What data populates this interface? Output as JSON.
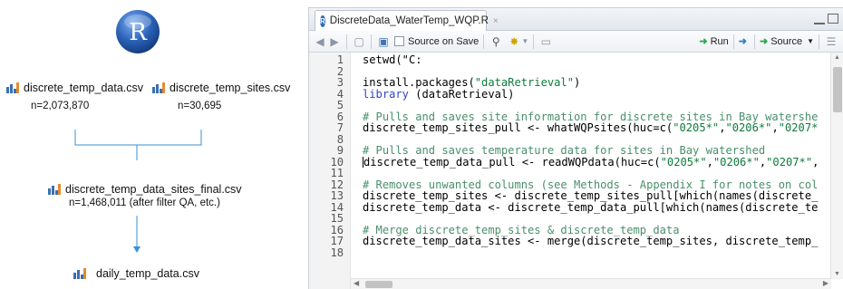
{
  "diagram": {
    "logo_letter": "R",
    "nodes": [
      {
        "id": "temp_data",
        "label": "discrete_temp_data.csv",
        "count": "n=2,073,870"
      },
      {
        "id": "temp_sites",
        "label": "discrete_temp_sites.csv",
        "count": "n=30,695"
      },
      {
        "id": "final",
        "label": "discrete_temp_data_sites_final.csv",
        "count": "n=1,468,011 (after filter QA, etc.)"
      },
      {
        "id": "daily",
        "label": "daily_temp_data.csv",
        "count": ""
      }
    ],
    "colors": {
      "logo": "#2a62b8",
      "connector": "#3a8fd6",
      "csv_icon": "#3a6fb0"
    }
  },
  "editor": {
    "tab_title": "DiscreteData_WaterTemp_WQP.R",
    "tab_icon": "r-file-icon",
    "tab_close": "×",
    "toolbar": {
      "source_on_save": "Source on Save",
      "run": "Run",
      "source": "Source"
    },
    "lines": [
      {
        "n": "1",
        "segments": [
          {
            "t": "setwd(\"C:",
            "c": ""
          }
        ]
      },
      {
        "n": "2",
        "segments": [
          {
            "t": "",
            "c": ""
          }
        ]
      },
      {
        "n": "3",
        "segments": [
          {
            "t": "install.packages(",
            "c": ""
          },
          {
            "t": "\"dataRetrieval\"",
            "c": "string"
          },
          {
            "t": ")",
            "c": ""
          }
        ]
      },
      {
        "n": "4",
        "segments": [
          {
            "t": "library",
            "c": "kw"
          },
          {
            "t": " (dataRetrieval)",
            "c": ""
          }
        ]
      },
      {
        "n": "5",
        "segments": [
          {
            "t": "",
            "c": ""
          }
        ]
      },
      {
        "n": "6",
        "segments": [
          {
            "t": "# Pulls and saves site information for discrete sites in Bay watershe",
            "c": "comment"
          }
        ]
      },
      {
        "n": "7",
        "segments": [
          {
            "t": "discrete_temp_sites_pull <- whatWQPsites(huc=c(",
            "c": ""
          },
          {
            "t": "\"0205*\"",
            "c": "string"
          },
          {
            "t": ",",
            "c": ""
          },
          {
            "t": "\"0206*\"",
            "c": "string"
          },
          {
            "t": ",",
            "c": ""
          },
          {
            "t": "\"0207*",
            "c": "string"
          }
        ]
      },
      {
        "n": "8",
        "segments": [
          {
            "t": "",
            "c": ""
          }
        ]
      },
      {
        "n": "9",
        "segments": [
          {
            "t": "# Pulls and saves temperature data for sites in Bay watershed",
            "c": "comment"
          }
        ]
      },
      {
        "n": "10",
        "cursor": true,
        "segments": [
          {
            "t": "discrete_temp_data_pull <- readWQPdata(huc=c(",
            "c": ""
          },
          {
            "t": "\"0205*\"",
            "c": "string"
          },
          {
            "t": ",",
            "c": ""
          },
          {
            "t": "\"0206*\"",
            "c": "string"
          },
          {
            "t": ",",
            "c": ""
          },
          {
            "t": "\"0207*\"",
            "c": "string"
          },
          {
            "t": ",",
            "c": ""
          }
        ]
      },
      {
        "n": "11",
        "segments": [
          {
            "t": "",
            "c": ""
          }
        ]
      },
      {
        "n": "12",
        "segments": [
          {
            "t": "# Removes unwanted columns (see Methods - Appendix I for notes on col",
            "c": "comment"
          }
        ]
      },
      {
        "n": "13",
        "segments": [
          {
            "t": "discrete_temp_sites <- discrete_temp_sites_pull[which(names(discrete_",
            "c": ""
          }
        ]
      },
      {
        "n": "14",
        "segments": [
          {
            "t": "discrete_temp_data <- discrete_temp_data_pull[which(names(discrete_te",
            "c": ""
          }
        ]
      },
      {
        "n": "15",
        "segments": [
          {
            "t": "",
            "c": ""
          }
        ]
      },
      {
        "n": "16",
        "segments": [
          {
            "t": "# Merge discrete_temp_sites & discrete_temp_data",
            "c": "comment"
          }
        ]
      },
      {
        "n": "17",
        "segments": [
          {
            "t": "discrete_temp_data_sites <- merge(discrete_temp_sites, discrete_temp_",
            "c": ""
          }
        ]
      },
      {
        "n": "18",
        "segments": [
          {
            "t": "",
            "c": ""
          }
        ]
      }
    ]
  }
}
